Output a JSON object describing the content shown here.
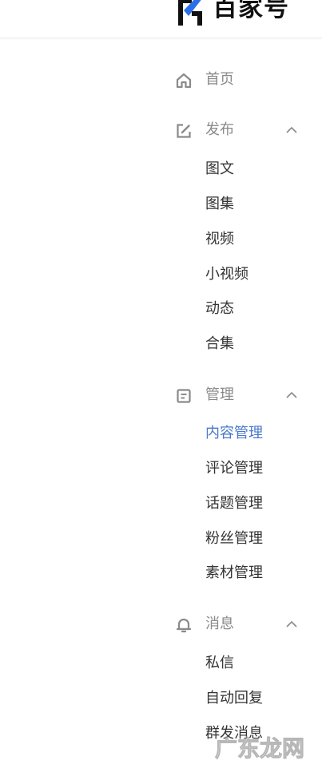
{
  "header": {
    "logo_text": "百家号"
  },
  "nav": {
    "home": {
      "label": "首页",
      "icon": "home-icon"
    },
    "publish": {
      "label": "发布",
      "icon": "edit-icon",
      "items": [
        "图文",
        "图集",
        "视频",
        "小视频",
        "动态",
        "合集"
      ]
    },
    "manage": {
      "label": "管理",
      "icon": "document-icon",
      "items": [
        "内容管理",
        "评论管理",
        "话题管理",
        "粉丝管理",
        "素材管理"
      ],
      "active_item": "内容管理"
    },
    "messages": {
      "label": "消息",
      "icon": "bell-icon",
      "items": [
        "私信",
        "自动回复",
        "群发消息"
      ]
    }
  },
  "watermark": {
    "text": "广东龙网"
  },
  "colors": {
    "active": "#4a78c8",
    "group_label": "#8a8a8a",
    "item_label": "#333333",
    "logo_blue": "#2b6fe8"
  }
}
